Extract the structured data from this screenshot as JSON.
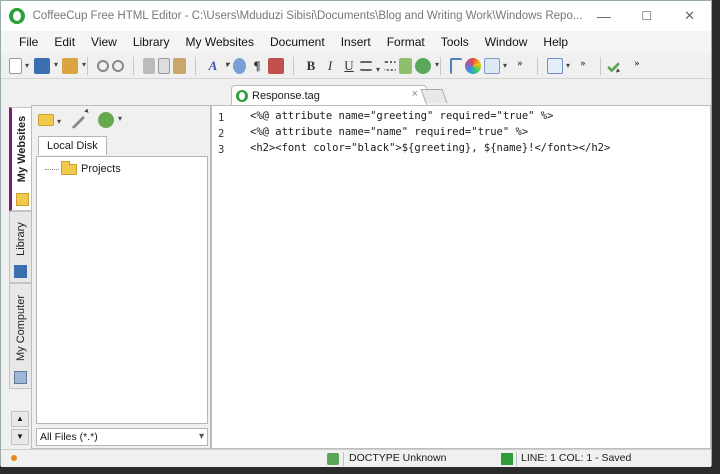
{
  "window": {
    "title": "CoffeeCup Free HTML Editor - C:\\Users\\Mduduzi Sibisi\\Documents\\Blog and Writing Work\\Windows Repo...",
    "controls": {
      "minimize": "—",
      "maximize": "☐",
      "close": "✕"
    }
  },
  "menu": [
    {
      "label": "File"
    },
    {
      "label": "Edit"
    },
    {
      "label": "View"
    },
    {
      "label": "Library"
    },
    {
      "label": "My Websites"
    },
    {
      "label": "Document"
    },
    {
      "label": "Insert"
    },
    {
      "label": "Format"
    },
    {
      "label": "Tools"
    },
    {
      "label": "Window"
    },
    {
      "label": "Help"
    }
  ],
  "toolbar": {
    "bold": "B",
    "italic": "I",
    "underline": "U",
    "more1": "»",
    "more2": "»",
    "more3": "»",
    "paragraph": "¶",
    "font": "A"
  },
  "side_tabs": {
    "my_websites": "My Websites",
    "library": "Library",
    "my_computer": "My Computer",
    "up": "▲",
    "down": "▼"
  },
  "file_panel": {
    "disk_tab": "Local Disk",
    "tree": [
      {
        "label": "Projects"
      }
    ],
    "filter": "All Files (*.*)",
    "filter_arrow": "▾"
  },
  "editor": {
    "tab_label": "Response.tag",
    "tab_close": "×",
    "lines": [
      {
        "num": "1",
        "text": "<%@ attribute name=\"greeting\" required=\"true\" %>"
      },
      {
        "num": "2",
        "text": "<%@ attribute name=\"name\" required=\"true\" %>"
      },
      {
        "num": "3",
        "text": "<h2><font color=\"black\">${greeting}, ${name}!</font></h2>"
      }
    ]
  },
  "status": {
    "doctype": "DOCTYPE Unknown",
    "position": "LINE: 1  COL: 1 - Saved"
  },
  "colors": {
    "accent_active_tab": "#7a1e6e",
    "logo_green": "#2e9e3a",
    "folder_yellow": "#f2c94c"
  }
}
